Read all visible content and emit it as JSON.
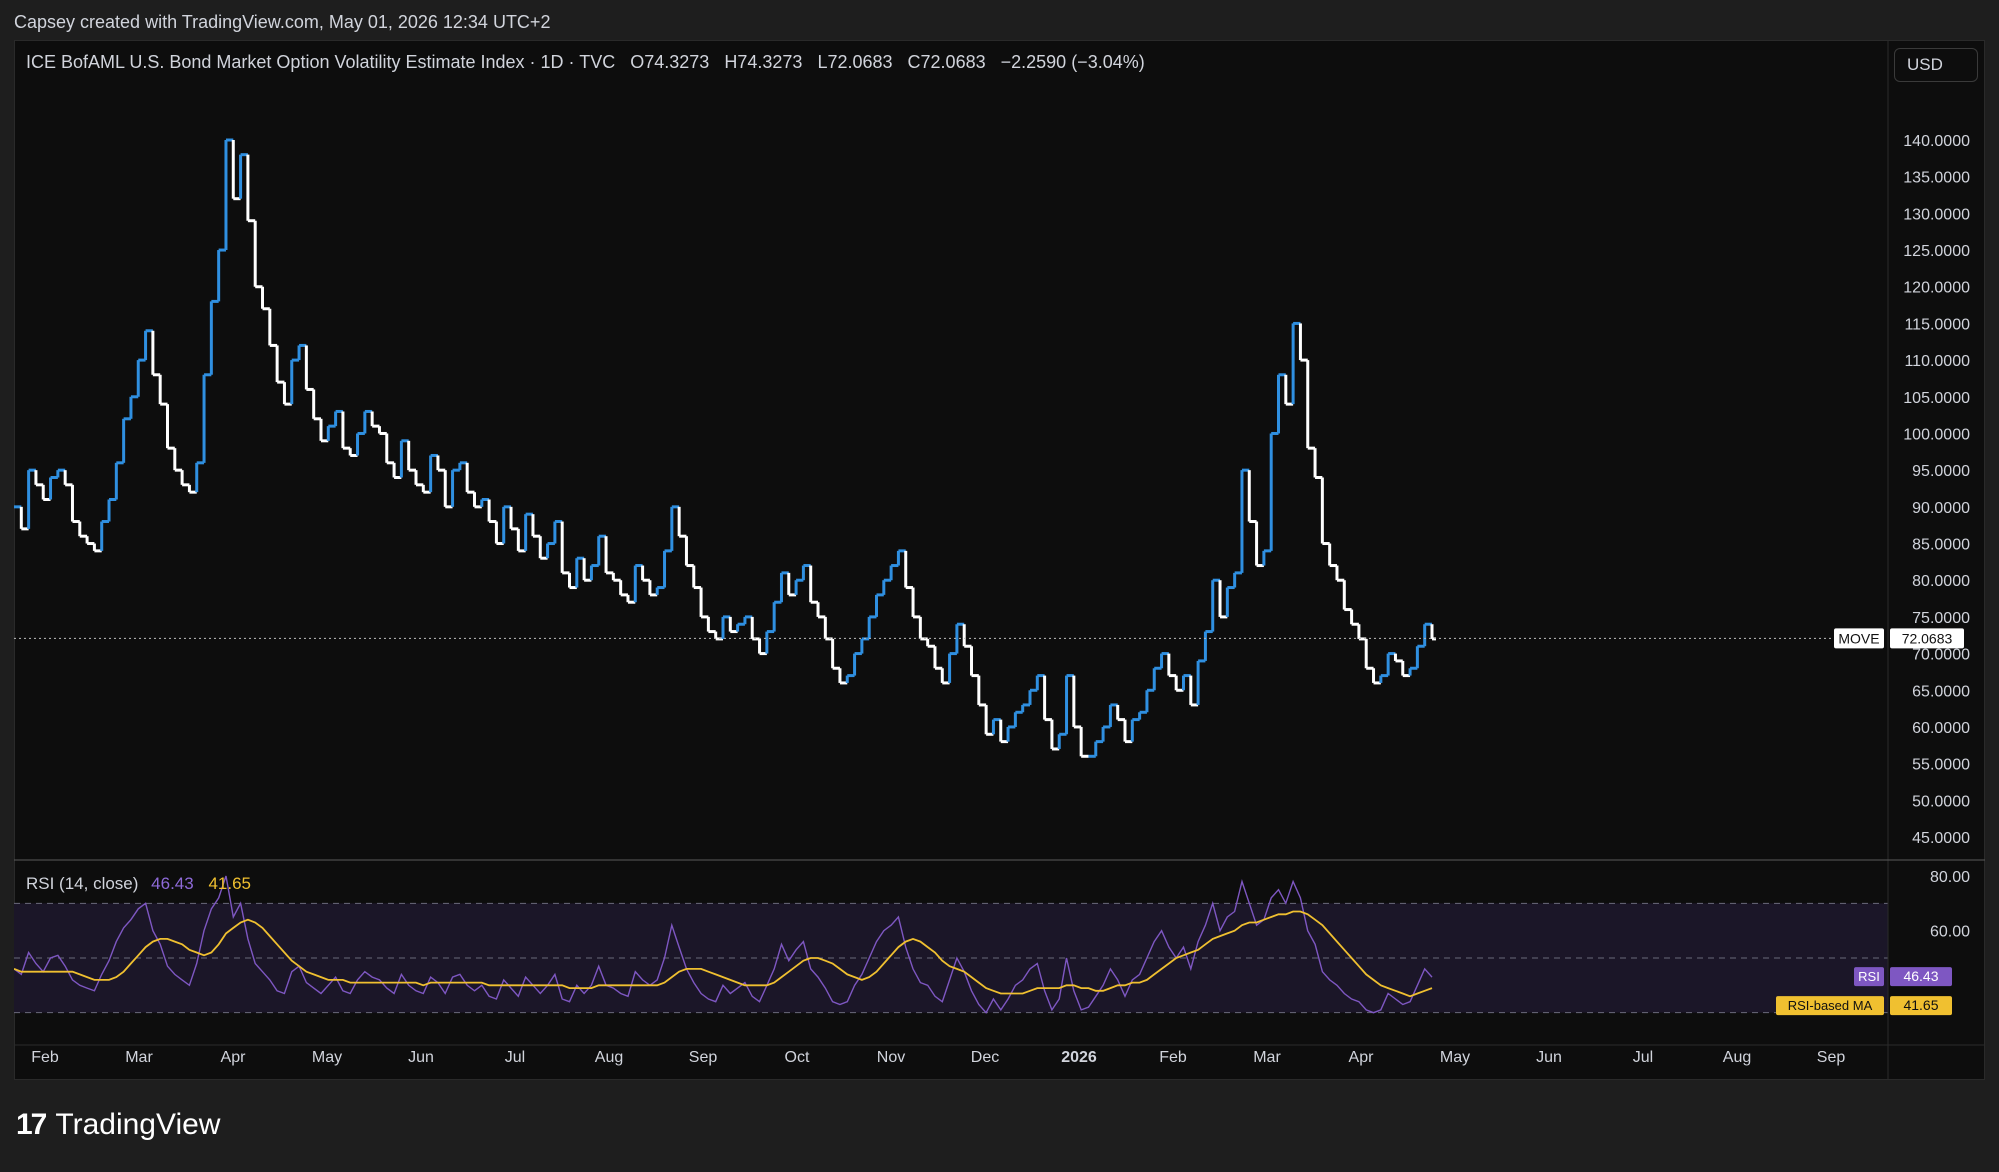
{
  "caption": "Capsey created with TradingView.com, May 01, 2026 12:34 UTC+2",
  "legend": {
    "symbol": "ICE BofAML U.S. Bond Market Option Volatility Estimate Index · 1D · TVC",
    "open": "O74.3273",
    "high": "H74.3273",
    "low": "L72.0683",
    "close": "C72.0683",
    "change": "−2.2590 (−3.04%)"
  },
  "currency_button": "USD",
  "price_tag": {
    "label": "MOVE",
    "value": "72.0683"
  },
  "rsi_legend": {
    "title": "RSI (14, close)",
    "rsi": "46.43",
    "ma": "41.65"
  },
  "rsi_tags": {
    "rsi_label": "RSI",
    "rsi_value": "46.43",
    "ma_label": "RSI-based MA",
    "ma_value": "41.65"
  },
  "footer": {
    "logo_glyph": "17",
    "brand": "TradingView"
  },
  "colors": {
    "up": "#2f8fe0",
    "down": "#ffffff",
    "rsi": "#7e57c2",
    "rsi_ma": "#f0c030",
    "background": "#0d0d0d",
    "rsi_band": "#1b1628"
  },
  "chart_data": [
    {
      "type": "line",
      "title": "ICE BofAML U.S. Bond Market Option Volatility Estimate Index",
      "style": "step line, colored blue on up moves and white on down moves",
      "x_labels": [
        "Feb",
        "Mar",
        "Apr",
        "May",
        "Jun",
        "Jul",
        "Aug",
        "Sep",
        "Oct",
        "Nov",
        "Dec",
        "2026",
        "Feb",
        "Mar",
        "Apr",
        "May",
        "Jun",
        "Jul",
        "Aug",
        "Sep"
      ],
      "y_ticks": [
        "140.0000",
        "135.0000",
        "130.0000",
        "125.0000",
        "120.0000",
        "115.0000",
        "110.0000",
        "105.0000",
        "100.0000",
        "95.0000",
        "90.0000",
        "85.0000",
        "80.0000",
        "75.0000",
        "70.0000",
        "65.0000",
        "60.0000",
        "55.0000",
        "50.0000",
        "45.0000"
      ],
      "ylim": [
        45,
        140
      ],
      "last_value": 72.0683,
      "series": [
        {
          "values": [
            90,
            87,
            95,
            93,
            91,
            94,
            95,
            93,
            88,
            86,
            85,
            84,
            88,
            91,
            96,
            102,
            105,
            110,
            114,
            108,
            104,
            98,
            95,
            93,
            92,
            96,
            108,
            118,
            125,
            140,
            132,
            138,
            129,
            120,
            117,
            112,
            107,
            104,
            110,
            112,
            106,
            102,
            99,
            101,
            103,
            98,
            97,
            100,
            103,
            101,
            100,
            96,
            94,
            99,
            95,
            93,
            92,
            97,
            95,
            90,
            95,
            96,
            92,
            90,
            91,
            88,
            85,
            90,
            87,
            84,
            89,
            86,
            83,
            85,
            88,
            81,
            79,
            83,
            80,
            82,
            86,
            81,
            80,
            78,
            77,
            82,
            80,
            78,
            79,
            84,
            90,
            86,
            82,
            79,
            75,
            73,
            72,
            75,
            73,
            74,
            75,
            72,
            70,
            73,
            77,
            81,
            78,
            80,
            82,
            77,
            75,
            72,
            68,
            66,
            67,
            70,
            72,
            75,
            78,
            80,
            82,
            84,
            79,
            75,
            72,
            71,
            68,
            66,
            70,
            74,
            71,
            67,
            63,
            59,
            61,
            58,
            60,
            62,
            63,
            65,
            67,
            61,
            57,
            59,
            67,
            60,
            56,
            56,
            58,
            60,
            63,
            61,
            58,
            61,
            62,
            65,
            68,
            70,
            67,
            65,
            67,
            63,
            69,
            73,
            80,
            75,
            79,
            81,
            95,
            88,
            82,
            84,
            100,
            108,
            104,
            115,
            110,
            98,
            94,
            85,
            82,
            80,
            76,
            74,
            72,
            68,
            66,
            67,
            70,
            69,
            67,
            68,
            71,
            74,
            72
          ]
        }
      ]
    },
    {
      "type": "line",
      "title": "RSI (14, close)",
      "y_ticks": [
        "80.00",
        "60.00"
      ],
      "ylim": [
        20,
        80
      ],
      "bands": [
        70,
        50,
        30
      ],
      "series": [
        {
          "name": "RSI",
          "values": [
            46,
            44,
            52,
            48,
            45,
            50,
            51,
            47,
            42,
            40,
            39,
            38,
            44,
            49,
            56,
            61,
            64,
            68,
            70,
            60,
            55,
            47,
            44,
            42,
            40,
            48,
            60,
            68,
            72,
            80,
            65,
            70,
            57,
            48,
            45,
            42,
            38,
            37,
            45,
            47,
            41,
            39,
            37,
            40,
            43,
            38,
            37,
            42,
            45,
            43,
            42,
            39,
            37,
            44,
            40,
            38,
            37,
            43,
            41,
            37,
            43,
            44,
            40,
            38,
            40,
            36,
            35,
            42,
            39,
            36,
            43,
            40,
            37,
            40,
            44,
            35,
            34,
            40,
            37,
            40,
            47,
            40,
            39,
            37,
            36,
            45,
            42,
            40,
            42,
            50,
            62,
            54,
            46,
            41,
            37,
            35,
            34,
            40,
            37,
            39,
            41,
            36,
            34,
            40,
            46,
            55,
            49,
            53,
            56,
            46,
            43,
            39,
            34,
            33,
            34,
            40,
            44,
            50,
            56,
            60,
            62,
            65,
            54,
            46,
            41,
            40,
            36,
            34,
            42,
            50,
            45,
            38,
            33,
            30,
            35,
            31,
            35,
            40,
            42,
            46,
            48,
            38,
            31,
            35,
            50,
            38,
            31,
            32,
            36,
            40,
            46,
            42,
            36,
            42,
            44,
            50,
            56,
            60,
            54,
            50,
            54,
            46,
            56,
            62,
            70,
            60,
            65,
            67,
            78,
            70,
            62,
            64,
            72,
            75,
            70,
            78,
            72,
            60,
            55,
            45,
            42,
            40,
            37,
            35,
            34,
            31,
            30,
            31,
            37,
            35,
            33,
            34,
            40,
            46,
            43
          ]
        },
        {
          "name": "RSI-based MA",
          "values": [
            46,
            45,
            45,
            45,
            45,
            45,
            45,
            45,
            45,
            44,
            43,
            42,
            42,
            42,
            43,
            45,
            48,
            51,
            54,
            56,
            57,
            57,
            56,
            55,
            53,
            52,
            51,
            52,
            55,
            59,
            61,
            63,
            64,
            63,
            61,
            58,
            55,
            52,
            49,
            47,
            45,
            44,
            43,
            42,
            42,
            42,
            41,
            41,
            41,
            41,
            41,
            41,
            41,
            41,
            41,
            41,
            40,
            41,
            41,
            41,
            41,
            41,
            41,
            41,
            41,
            40,
            40,
            40,
            40,
            40,
            40,
            40,
            40,
            40,
            40,
            40,
            39,
            39,
            39,
            39,
            40,
            40,
            40,
            40,
            40,
            40,
            40,
            40,
            40,
            41,
            43,
            45,
            46,
            46,
            46,
            45,
            44,
            43,
            42,
            41,
            40,
            40,
            40,
            40,
            41,
            43,
            45,
            47,
            49,
            50,
            50,
            49,
            48,
            46,
            44,
            43,
            42,
            43,
            45,
            48,
            51,
            54,
            56,
            57,
            56,
            54,
            52,
            49,
            47,
            46,
            45,
            43,
            41,
            39,
            38,
            37,
            37,
            37,
            37,
            38,
            39,
            39,
            39,
            39,
            40,
            40,
            39,
            39,
            38,
            38,
            39,
            40,
            40,
            41,
            41,
            42,
            44,
            46,
            48,
            50,
            51,
            52,
            53,
            55,
            57,
            58,
            59,
            60,
            62,
            63,
            63,
            64,
            65,
            66,
            66,
            67,
            67,
            66,
            64,
            62,
            59,
            56,
            53,
            50,
            47,
            44,
            42,
            40,
            39,
            38,
            37,
            36,
            37,
            38,
            39
          ]
        }
      ]
    }
  ]
}
